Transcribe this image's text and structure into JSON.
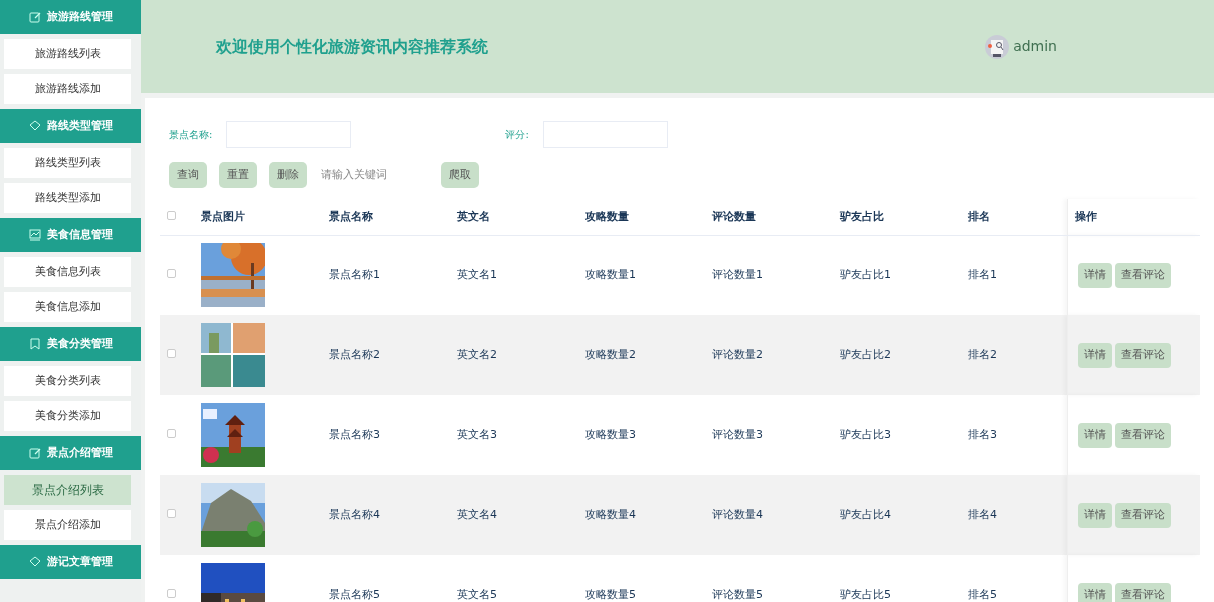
{
  "sidebar": {
    "groups": [
      {
        "title": "旅游路线管理",
        "items": [
          {
            "label": "旅游路线列表",
            "selected": false
          },
          {
            "label": "旅游路线添加",
            "selected": false
          }
        ]
      },
      {
        "title": "路线类型管理",
        "items": [
          {
            "label": "路线类型列表",
            "selected": false
          },
          {
            "label": "路线类型添加",
            "selected": false
          }
        ]
      },
      {
        "title": "美食信息管理",
        "items": [
          {
            "label": "美食信息列表",
            "selected": false
          },
          {
            "label": "美食信息添加",
            "selected": false
          }
        ]
      },
      {
        "title": "美食分类管理",
        "items": [
          {
            "label": "美食分类列表",
            "selected": false
          },
          {
            "label": "美食分类添加",
            "selected": false
          }
        ]
      },
      {
        "title": "景点介绍管理",
        "items": [
          {
            "label": "景点介绍列表",
            "selected": true
          },
          {
            "label": "景点介绍添加",
            "selected": false
          }
        ]
      },
      {
        "title": "游记文章管理"
      }
    ]
  },
  "header": {
    "title": "欢迎使用个性化旅游资讯内容推荐系统",
    "user": "admin"
  },
  "search": {
    "fields": [
      {
        "label": "景点名称:"
      },
      {
        "label": "评分:"
      }
    ],
    "buttons": [
      "查询",
      "重置",
      "删除"
    ],
    "keyword": {
      "placeholder": "请输入关键词"
    },
    "crawl_button": "爬取"
  },
  "table": {
    "header_checked": false,
    "picture_header": "景点图片",
    "columns": [
      "景点名称",
      "英文名",
      "攻略数量",
      "评论数量",
      "驴友占比",
      "排名",
      "操作"
    ],
    "rows": [
      {
        "checked": false,
        "cells": [
          "景点名称1",
          "英文名1",
          "攻略数量1",
          "评论数量1",
          "驴友占比1",
          "排名1"
        ],
        "actions": [
          "详情",
          "查看评论"
        ]
      },
      {
        "checked": false,
        "cells": [
          "景点名称2",
          "英文名2",
          "攻略数量2",
          "评论数量2",
          "驴友占比2",
          "排名2"
        ],
        "actions": [
          "详情",
          "查看评论"
        ]
      },
      {
        "checked": false,
        "cells": [
          "景点名称3",
          "英文名3",
          "攻略数量3",
          "评论数量3",
          "驴友占比3",
          "排名3"
        ],
        "actions": [
          "详情",
          "查看评论"
        ]
      },
      {
        "checked": false,
        "cells": [
          "景点名称4",
          "英文名4",
          "攻略数量4",
          "评论数量4",
          "驴友占比4",
          "排名4"
        ],
        "actions": [
          "详情",
          "查看评论"
        ]
      },
      {
        "checked": false,
        "cells": [
          "景点名称5",
          "英文名5",
          "攻略数量5",
          "评论数量5",
          "驴友占比5",
          "排名5"
        ],
        "actions": [
          "详情",
          "查看评论"
        ]
      }
    ]
  }
}
